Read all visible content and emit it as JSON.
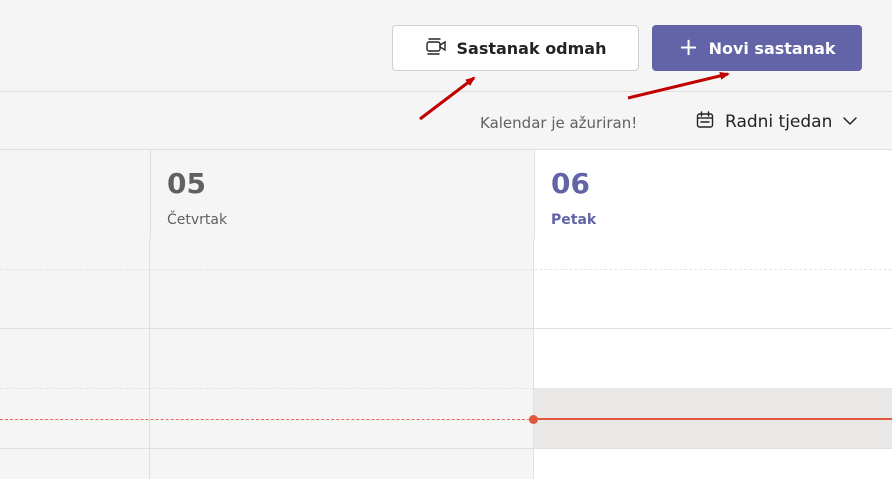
{
  "toolbar": {
    "meet_now_label": "Sastanak odmah",
    "meet_now_icon": "video-camera-icon",
    "new_meeting_label": "Novi sastanak",
    "new_meeting_icon": "plus-icon",
    "accent_color": "#6264a7"
  },
  "subbar": {
    "status_text": "Kalendar je ažuriran!",
    "view_label": "Radni tjedan",
    "view_icon": "calendar-icon",
    "view_chevron": "chevron-down-icon"
  },
  "days": [
    {
      "number": "05",
      "name": "Četvrtak",
      "is_today": false
    },
    {
      "number": "06",
      "name": "Petak",
      "is_today": true
    }
  ],
  "current_time_color": "#e2583e"
}
